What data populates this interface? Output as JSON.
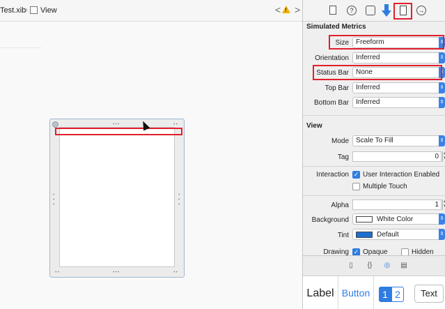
{
  "jumpbar": {
    "file_name": "Test.xib",
    "view_name": "View",
    "back_label": "<",
    "forward_label": ">"
  },
  "inspector": {
    "tabs": [
      "file-icon",
      "help-icon",
      "identity-icon",
      "attributes-icon",
      "size-icon",
      "connections-icon"
    ],
    "help_glyph": "?",
    "conn_glyph": "→",
    "simulated_metrics": {
      "title": "Simulated Metrics",
      "size": {
        "label": "Size",
        "value": "Freeform"
      },
      "orientation": {
        "label": "Orientation",
        "value": "Inferred"
      },
      "status_bar": {
        "label": "Status Bar",
        "value": "None"
      },
      "top_bar": {
        "label": "Top Bar",
        "value": "Inferred"
      },
      "bottom_bar": {
        "label": "Bottom Bar",
        "value": "Inferred"
      }
    },
    "view": {
      "title": "View",
      "mode": {
        "label": "Mode",
        "value": "Scale To Fill"
      },
      "tag": {
        "label": "Tag",
        "value": "0"
      },
      "interaction": {
        "label": "Interaction",
        "user_interaction": "User Interaction Enabled",
        "multiple_touch": "Multiple Touch"
      },
      "alpha": {
        "label": "Alpha",
        "value": "1"
      },
      "background": {
        "label": "Background",
        "value": "White Color",
        "swatch": "#ffffff"
      },
      "tint": {
        "label": "Tint",
        "value": "Default",
        "swatch": "#1f6fd1"
      },
      "drawing": {
        "label": "Drawing",
        "opaque": "Opaque",
        "hidden": "Hidden"
      }
    }
  },
  "library": {
    "items": {
      "label": "Label",
      "button": "Button",
      "seg1": "1",
      "seg2": "2",
      "text": "Text"
    }
  },
  "colors": {
    "accent": "#2f7de1",
    "highlight": "#e0202c"
  }
}
